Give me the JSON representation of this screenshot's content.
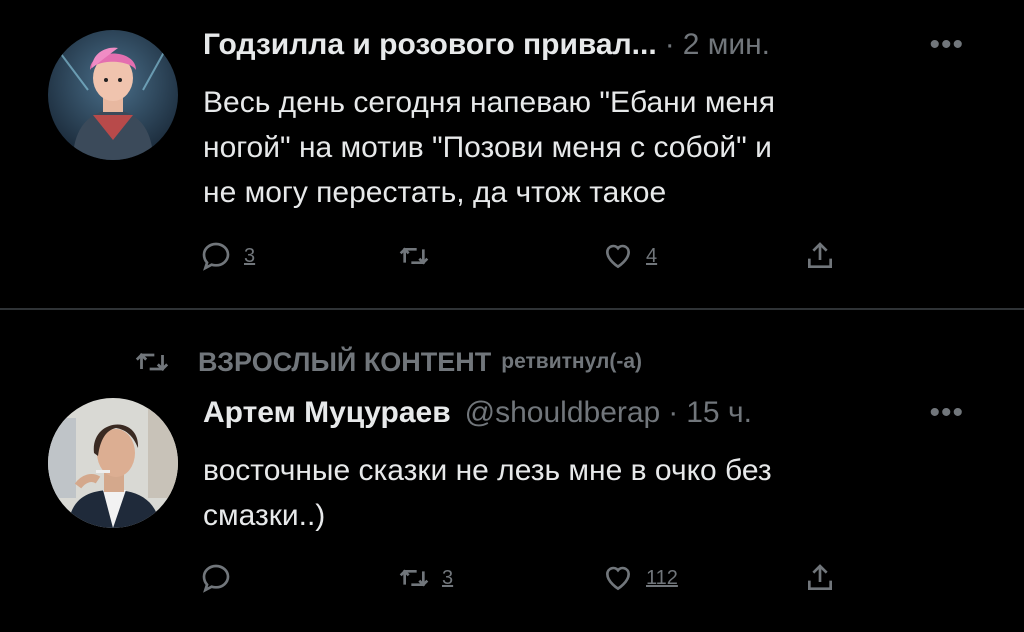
{
  "tweets": [
    {
      "author": "Годзилла и розового привал...",
      "handle": "",
      "time": "2 мин.",
      "text": "Весь день сегодня напеваю \"Ебани меня\nногой\" на мотив \"Позови меня с собой\" и\nне могу перестать, да чтож такое",
      "replies": "3",
      "retweets": "",
      "likes": "4",
      "avatar_icon": "illustrated-character-avatar"
    },
    {
      "retweet_banner": {
        "who": "ВЗРОСЛЫЙ КОНТЕНТ",
        "verb": "ретвитнул(-а)"
      },
      "author": "Артем Муцураев",
      "handle": "@shouldberap",
      "time": "15 ч.",
      "text": "восточные сказки не лезь мне в очко без\nсмазки..)",
      "replies": "",
      "retweets": "3",
      "likes": "112",
      "avatar_icon": "person-photo-avatar"
    }
  ],
  "ui": {
    "more_label": "•••",
    "dot": "·"
  },
  "colors": {
    "background": "#000000",
    "text": "#e7e9ea",
    "muted": "#71767b",
    "divider": "#2f3336"
  }
}
